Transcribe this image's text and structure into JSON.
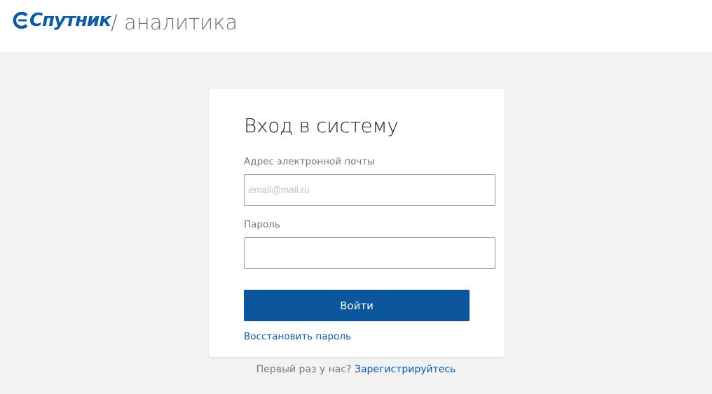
{
  "header": {
    "logo_text": "Спутник",
    "section_title": "/ аналитика",
    "brand_color": "#0d5aa7"
  },
  "login": {
    "title": "Вход в систему",
    "email_label": "Адрес электронной почты",
    "email_placeholder": "email@mail.ru",
    "email_value": "",
    "password_label": "Пароль",
    "password_value": "",
    "submit_label": "Войти",
    "restore_link": "Восстановить пароль",
    "button_color": "#0a559c"
  },
  "footer": {
    "first_time_text": "Первый раз у нас?",
    "register_link": "Зарегистрируйтесь"
  }
}
